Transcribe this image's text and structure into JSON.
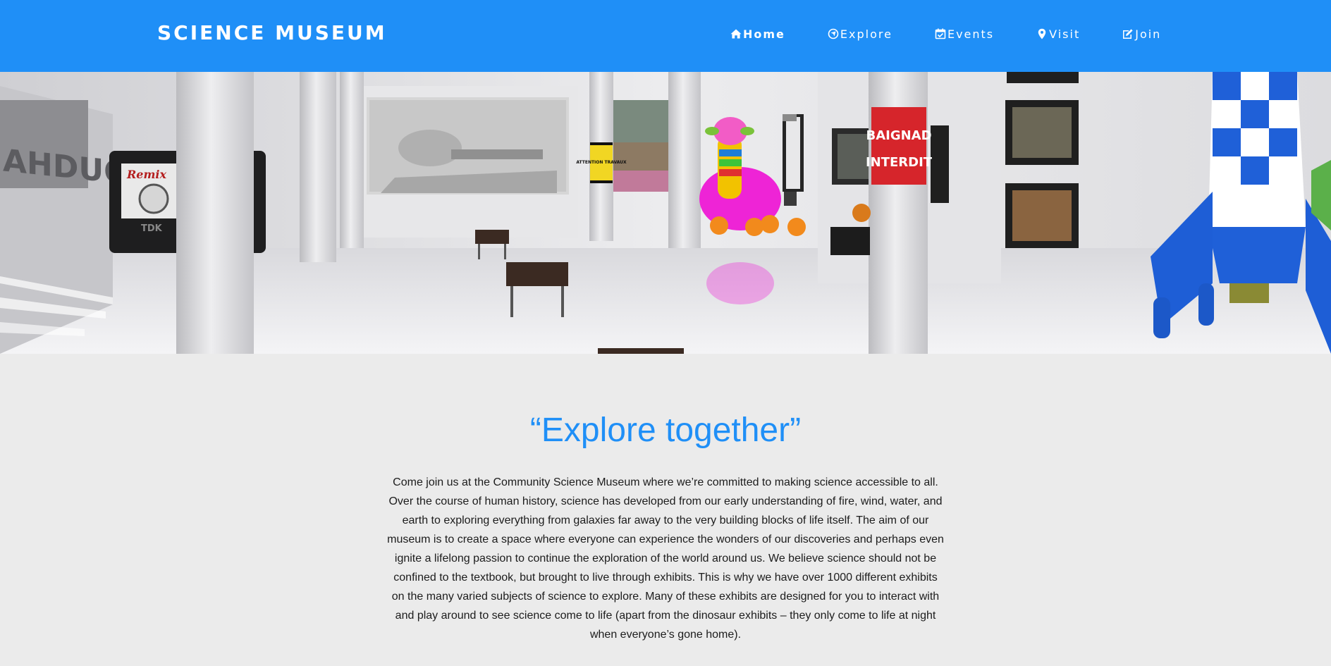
{
  "brand": {
    "title": "SCIENCE MUSEUM"
  },
  "nav": {
    "items": [
      {
        "label": "Home",
        "icon": "home-icon",
        "active": true
      },
      {
        "label": "Explore",
        "icon": "compass-icon",
        "active": false
      },
      {
        "label": "Events",
        "icon": "calendar-check-icon",
        "active": false
      },
      {
        "label": "Visit",
        "icon": "map-marker-icon",
        "active": false
      },
      {
        "label": "Join",
        "icon": "edit-icon",
        "active": false
      }
    ]
  },
  "hero": {
    "sign_left": "ATTENTION TRAVAUX",
    "sign_right_1": "BAIGNAD",
    "sign_right_2": "INTERDIT",
    "cassette_label": "Remix",
    "cassette_brand": "TDK",
    "wall_letters": "AHDUOSJI"
  },
  "intro": {
    "title": "“Explore together”",
    "body": "Come join us at the Community Science Museum where we’re committed to making science accessible to all. Over the course of human history, science has developed from our early understanding of fire, wind, water, and earth to exploring everything from galaxies far away to the very building blocks of life itself. The aim of our museum is to create a space where everyone can experience the wonders of our discoveries and perhaps even ignite a lifelong passion to continue the exploration of the world around us. We believe science should not be confined to the textbook, but brought to live through exhibits. This is why we have over 1000 different exhibits on the many varied subjects of science to explore. Many of these exhibits are designed for you to interact with and play around to see science come to life (apart from the dinosaur exhibits – they only come to life at night when everyone’s gone home)."
  },
  "colors": {
    "header": "#1f8ff7",
    "title": "#1f8ff7",
    "page_bg": "#ebebeb",
    "text": "#1c1c1c"
  }
}
